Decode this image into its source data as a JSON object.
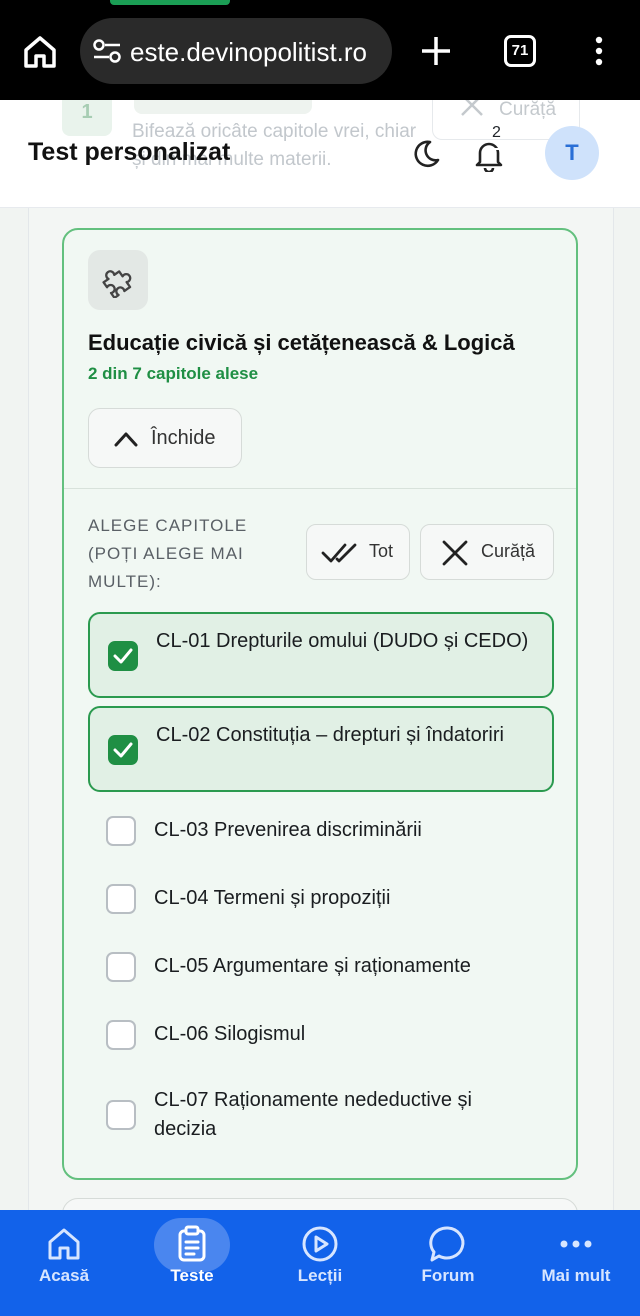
{
  "browser": {
    "url": "este.devinopolitist.ro",
    "tab_count": "71"
  },
  "behind": {
    "step_number": "1",
    "hint": "Bifează oricâte capitole vrei, chiar și din mai multe materii.",
    "clear_label": "Curăță"
  },
  "header": {
    "title": "Test personalizat",
    "notification_count": "2",
    "avatar_letter": "T"
  },
  "subject": {
    "name": "Educație civică și cetățenească & Logică",
    "selected_count": "2 din 7 capitole alese",
    "close_label": "Închide",
    "choose_label": "ALEGE CAPITOLE (POȚI ALEGE MAI MULTE):",
    "select_all_label": "Tot",
    "clear_label": "Curăță",
    "chapters": [
      {
        "label": "CL-01 Drepturile omului (DUDO și CEDO)",
        "checked": true
      },
      {
        "label": "CL-02 Constituția – drepturi și îndatoriri",
        "checked": true
      },
      {
        "label": "CL-03 Prevenirea discriminării",
        "checked": false
      },
      {
        "label": "CL-04 Termeni și propoziții",
        "checked": false
      },
      {
        "label": "CL-05 Argumentare și raționamente",
        "checked": false
      },
      {
        "label": "CL-06 Silogismul",
        "checked": false
      },
      {
        "label": "CL-07 Raționamente nedeductive și decizia",
        "checked": false
      }
    ]
  },
  "nav": {
    "items": [
      {
        "label": "Acasă",
        "icon": "home-icon",
        "active": false
      },
      {
        "label": "Teste",
        "icon": "clipboard-icon",
        "active": true
      },
      {
        "label": "Lecții",
        "icon": "play-circle-icon",
        "active": false
      },
      {
        "label": "Forum",
        "icon": "chat-bubble-icon",
        "active": false
      },
      {
        "label": "Mai mult",
        "icon": "more-dots-icon",
        "active": false
      }
    ]
  },
  "colors": {
    "accent_green": "#1f8f44",
    "nav_blue": "#1262ea",
    "badge_red": "#e5343d"
  }
}
